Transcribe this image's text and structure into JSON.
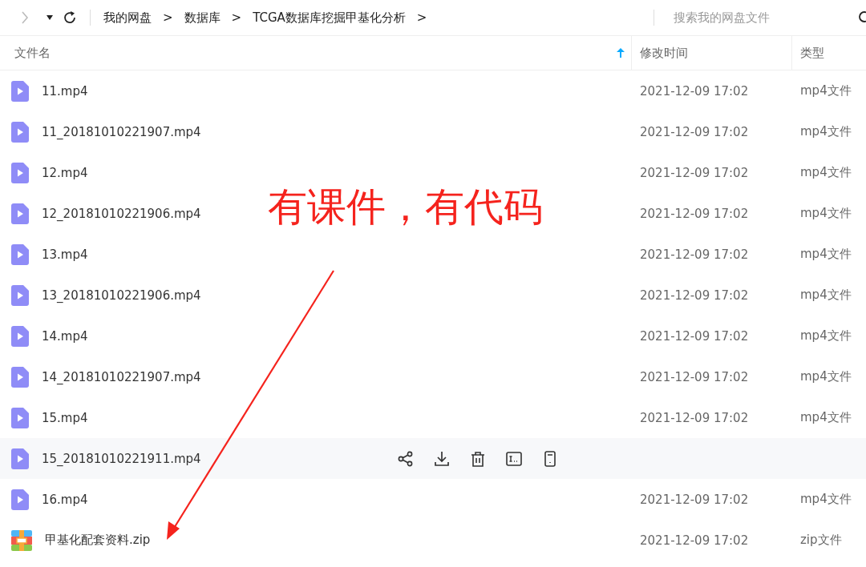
{
  "toolbar": {
    "breadcrumbs": [
      "我的网盘",
      "数据库",
      "TCGA数据库挖掘甲基化分析"
    ],
    "separator": ">",
    "search": {
      "placeholder": "搜索我的网盘文件"
    }
  },
  "table": {
    "columns": [
      {
        "label": "文件名",
        "sorted": true
      },
      {
        "label": "修改时间",
        "sorted": false
      },
      {
        "label": "类型",
        "sorted": false
      }
    ],
    "rows": [
      {
        "kind": "video",
        "name": "11.mp4",
        "modified": "2021-12-09 17:02",
        "type": "mp4文件",
        "hovered": false
      },
      {
        "kind": "video",
        "name": "11_20181010221907.mp4",
        "modified": "2021-12-09 17:02",
        "type": "mp4文件",
        "hovered": false
      },
      {
        "kind": "video",
        "name": "12.mp4",
        "modified": "2021-12-09 17:02",
        "type": "mp4文件",
        "hovered": false
      },
      {
        "kind": "video",
        "name": "12_20181010221906.mp4",
        "modified": "2021-12-09 17:02",
        "type": "mp4文件",
        "hovered": false
      },
      {
        "kind": "video",
        "name": "13.mp4",
        "modified": "2021-12-09 17:02",
        "type": "mp4文件",
        "hovered": false
      },
      {
        "kind": "video",
        "name": "13_20181010221906.mp4",
        "modified": "2021-12-09 17:02",
        "type": "mp4文件",
        "hovered": false
      },
      {
        "kind": "video",
        "name": "14.mp4",
        "modified": "2021-12-09 17:02",
        "type": "mp4文件",
        "hovered": false
      },
      {
        "kind": "video",
        "name": "14_20181010221907.mp4",
        "modified": "2021-12-09 17:02",
        "type": "mp4文件",
        "hovered": false
      },
      {
        "kind": "video",
        "name": "15.mp4",
        "modified": "2021-12-09 17:02",
        "type": "mp4文件",
        "hovered": false
      },
      {
        "kind": "video",
        "name": "15_20181010221911.mp4",
        "hovered": true
      },
      {
        "kind": "video",
        "name": "16.mp4",
        "modified": "2021-12-09 17:02",
        "type": "mp4文件",
        "hovered": false
      },
      {
        "kind": "archive",
        "name": "甲基化配套资料.zip",
        "modified": "2021-12-09 17:02",
        "type": "zip文件",
        "hovered": false
      }
    ]
  },
  "annotation": {
    "text": "有课件，有代码"
  }
}
